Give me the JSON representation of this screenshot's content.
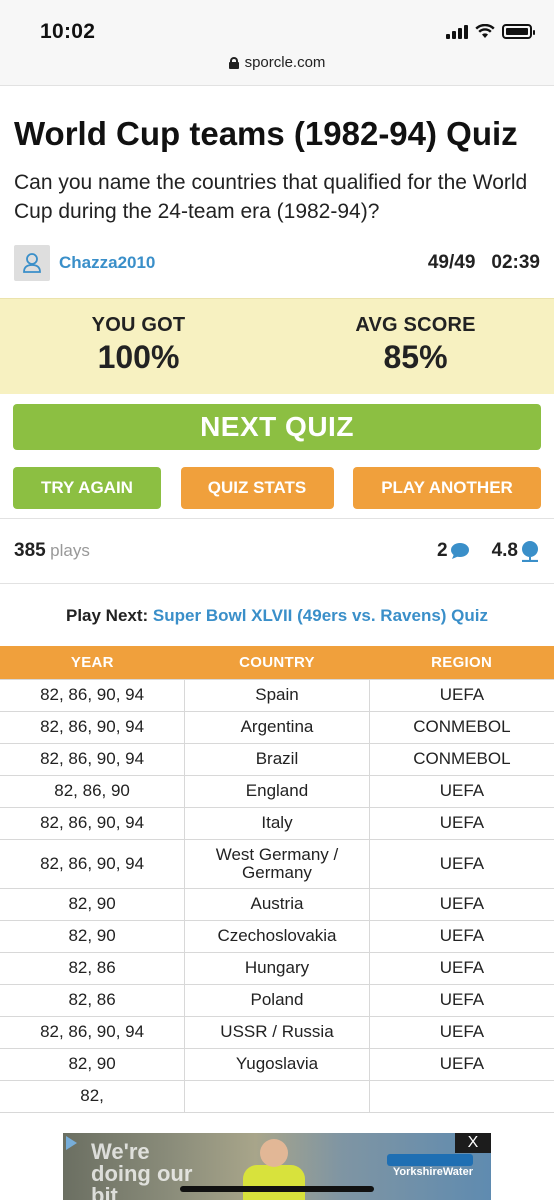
{
  "status": {
    "time": "10:02"
  },
  "browser": {
    "url": "sporcle.com"
  },
  "quiz": {
    "title": "World Cup teams (1982-94) Quiz",
    "description": "Can you name the countries that qualified for the World Cup during the 24-team era (1982-94)?",
    "author": "Chazza2010",
    "progress": "49/49",
    "timer": "02:39"
  },
  "score": {
    "you_label": "YOU GOT",
    "you_value": "100%",
    "avg_label": "AVG SCORE",
    "avg_value": "85%"
  },
  "buttons": {
    "next": "NEXT QUIZ",
    "try_again": "TRY AGAIN",
    "quiz_stats": "QUIZ STATS",
    "play_another": "PLAY ANOTHER"
  },
  "stats": {
    "plays": "385",
    "plays_label": "plays",
    "comments": "2",
    "rating": "4.8"
  },
  "play_next": {
    "label": "Play Next:",
    "link": "Super Bowl XLVII (49ers vs. Ravens) Quiz"
  },
  "table": {
    "headers": [
      "YEAR",
      "COUNTRY",
      "REGION"
    ],
    "rows": [
      [
        "82, 86, 90, 94",
        "Spain",
        "UEFA"
      ],
      [
        "82, 86, 90, 94",
        "Argentina",
        "CONMEBOL"
      ],
      [
        "82, 86, 90, 94",
        "Brazil",
        "CONMEBOL"
      ],
      [
        "82, 86, 90",
        "England",
        "UEFA"
      ],
      [
        "82, 86, 90, 94",
        "Italy",
        "UEFA"
      ],
      [
        "82, 86, 90, 94",
        "West Germany / Germany",
        "UEFA"
      ],
      [
        "82, 90",
        "Austria",
        "UEFA"
      ],
      [
        "82, 90",
        "Czechoslovakia",
        "UEFA"
      ],
      [
        "82, 86",
        "Hungary",
        "UEFA"
      ],
      [
        "82, 86",
        "Poland",
        "UEFA"
      ],
      [
        "82, 86, 90, 94",
        "USSR / Russia",
        "UEFA"
      ],
      [
        "82, 90",
        "Yugoslavia",
        "UEFA"
      ],
      [
        "82,",
        "",
        ""
      ]
    ]
  },
  "ad": {
    "text": "We're doing our bit",
    "brand": "YorkshireWater",
    "close": "X"
  }
}
